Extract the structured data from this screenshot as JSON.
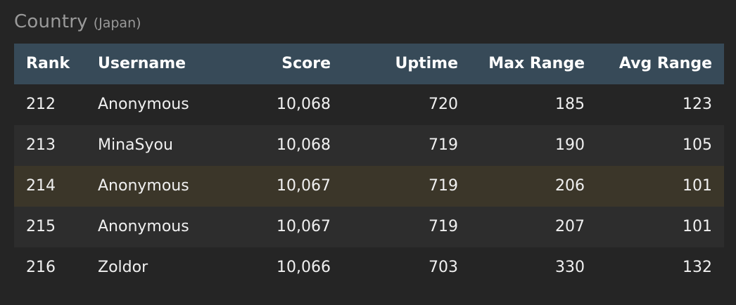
{
  "section": {
    "title": "Country",
    "subtitle": "(Japan)"
  },
  "table": {
    "columns": [
      "Rank",
      "Username",
      "Score",
      "Uptime",
      "Max Range",
      "Avg Range"
    ],
    "rows": [
      {
        "rank": "212",
        "username": "Anonymous",
        "score": "10,068",
        "uptime": "720",
        "max_range": "185",
        "avg_range": "123",
        "highlighted": false
      },
      {
        "rank": "213",
        "username": "MinaSyou",
        "score": "10,068",
        "uptime": "719",
        "max_range": "190",
        "avg_range": "105",
        "highlighted": false
      },
      {
        "rank": "214",
        "username": "Anonymous",
        "score": "10,067",
        "uptime": "719",
        "max_range": "206",
        "avg_range": "101",
        "highlighted": true
      },
      {
        "rank": "215",
        "username": "Anonymous",
        "score": "10,067",
        "uptime": "719",
        "max_range": "207",
        "avg_range": "101",
        "highlighted": false
      },
      {
        "rank": "216",
        "username": "Zoldor",
        "score": "10,066",
        "uptime": "703",
        "max_range": "330",
        "avg_range": "132",
        "highlighted": false
      }
    ]
  },
  "colors": {
    "background": "#252525",
    "header_background": "#374a58",
    "row_alt_background": "#2d2d2d",
    "highlight_background": "#3b3629",
    "heading_text": "#9a9a9a",
    "cell_text": "#f0f0f0"
  }
}
